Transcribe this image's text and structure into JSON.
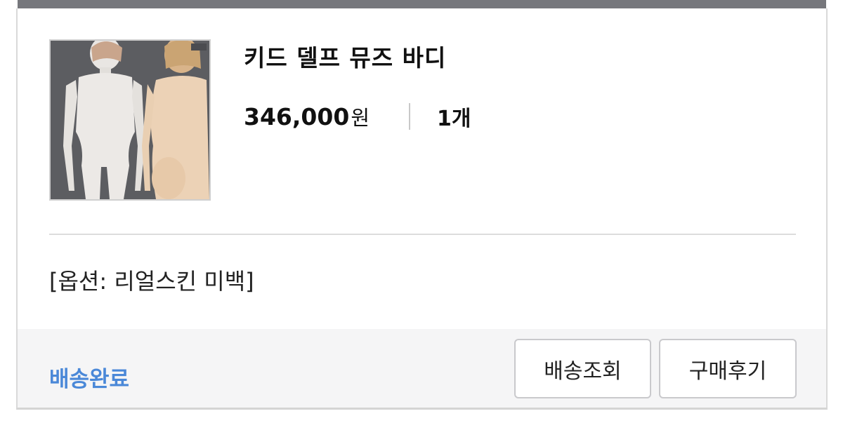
{
  "order_item": {
    "product_name": "키드 델프 뮤즈 바디",
    "price": "346,000",
    "currency": "원",
    "quantity": "1개",
    "option": "[옵션: 리얼스킨 미백]",
    "image_icon": "doll-body-photo"
  },
  "footer": {
    "status": "배송완료",
    "track_label": "배송조회",
    "review_label": "구매후기"
  },
  "colors": {
    "status": "#4a88d8",
    "top_bar": "#76777c",
    "footer_bg": "#f5f5f6"
  }
}
